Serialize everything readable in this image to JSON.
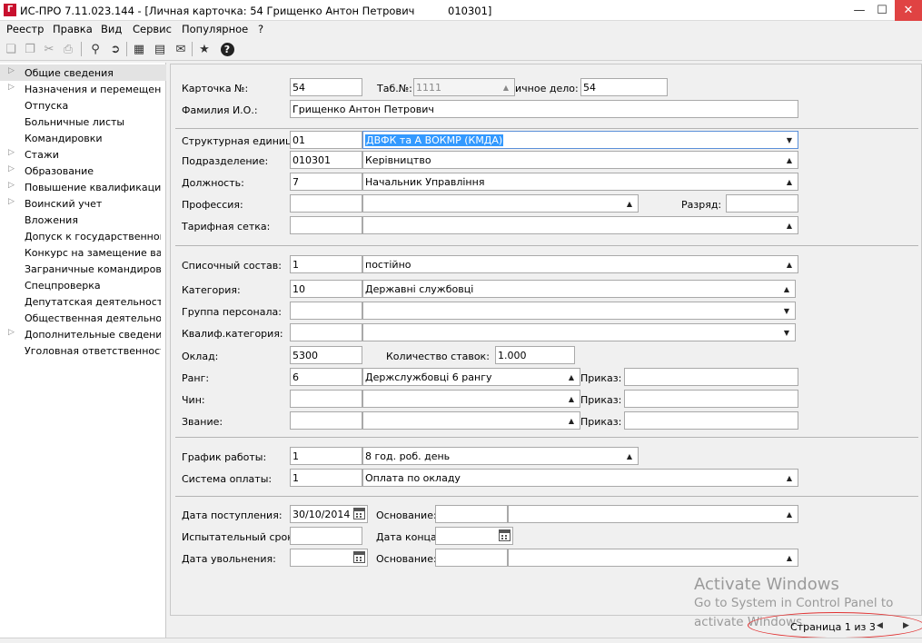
{
  "window": {
    "title": "ИС-ПРО 7.11.023.144 - [Личная карточка: 54 Грищенко Антон Петрович          010301]",
    "icon_text": "Г"
  },
  "menu": [
    "Реестр",
    "Правка",
    "Вид",
    "Сервис",
    "Популярное",
    "?"
  ],
  "toolbar": {
    "icons": [
      "copy-icon",
      "paste-icon",
      "cut-icon",
      "print-icon",
      "search-icon",
      "find-next-icon",
      "chart-icon",
      "document-icon",
      "mail-icon",
      "star-icon",
      "help-icon"
    ]
  },
  "nav": {
    "items": [
      {
        "label": "Общие сведения",
        "expander": "▷"
      },
      {
        "label": "Назначения и перемещения",
        "expander": "▷"
      },
      {
        "label": "Отпуска",
        "expander": ""
      },
      {
        "label": "Больничные листы",
        "expander": ""
      },
      {
        "label": "Командировки",
        "expander": ""
      },
      {
        "label": "Стажи",
        "expander": "▷"
      },
      {
        "label": "Образование",
        "expander": "▷"
      },
      {
        "label": "Повышение квалификации",
        "expander": "▷"
      },
      {
        "label": "Воинский учет",
        "expander": "▷"
      },
      {
        "label": "Вложения",
        "expander": ""
      },
      {
        "label": "Допуск к государственной...",
        "expander": ""
      },
      {
        "label": "Конкурс на замещение вак...",
        "expander": ""
      },
      {
        "label": "Заграничные командировки",
        "expander": ""
      },
      {
        "label": "Спецпроверка",
        "expander": ""
      },
      {
        "label": "Депутатская деятельность",
        "expander": ""
      },
      {
        "label": "Общественная деятельно...",
        "expander": ""
      },
      {
        "label": "Дополнительные сведени...",
        "expander": "▷"
      },
      {
        "label": "Уголовная ответственность",
        "expander": ""
      }
    ]
  },
  "card": {
    "card_label": "Карточка  №:",
    "card_no": "54",
    "tab_label": "Таб.№:",
    "tab_value": "1111",
    "file_label": "ичное дело:",
    "file_value": "54",
    "fio_label": "Фамилия И.О.:",
    "fio_value": "Грищенко Антон Петрович"
  },
  "org": {
    "unit_label": "Структурная единица:",
    "unit_code": "01",
    "unit_name": "ДВФК та А ВОКМР (КМДА)",
    "dept_label": "Подразделение:",
    "dept_code": "010301",
    "dept_name": "Керівництво",
    "pos_label": "Должность:",
    "pos_code": "7",
    "pos_name": "Начальник Управління",
    "prof_label": "Профессия:",
    "prof_code": "",
    "prof_name": "",
    "grade_label": "Разряд:",
    "grade_value": "",
    "tariff_label": "Тарифная сетка:",
    "tariff_code": "",
    "tariff_name": ""
  },
  "staff": {
    "list_label": "Списочный состав:",
    "list_code": "1",
    "list_name": "постійно",
    "cat_label": "Категория:",
    "cat_code": "10",
    "cat_name": "Державні службовці",
    "group_label": "Группа персонала:",
    "group_code": "",
    "group_name": "",
    "qual_label": "Квалиф.категория:",
    "qual_code": "",
    "qual_name": "",
    "salary_label": "Оклад:",
    "salary_value": "5300",
    "rates_label": "Количество ставок:",
    "rates_value": "1.000",
    "rank_label": "Ранг:",
    "rank_code": "6",
    "rank_name": "Держслужбовці 6 рангу",
    "rank_order_label": "Приказ:",
    "rank_order": "",
    "chin_label": "Чин:",
    "chin_code": "",
    "chin_name": "",
    "chin_order_label": "Приказ:",
    "chin_order": "",
    "title_label": "Звание:",
    "title_code": "",
    "title_name": "",
    "title_order_label": "Приказ:",
    "title_order": ""
  },
  "work": {
    "schedule_label": "График работы:",
    "schedule_code": "1",
    "schedule_name": "8 год. роб. день",
    "pay_label": "Система оплаты:",
    "pay_code": "1",
    "pay_name": "Оплата по окладу"
  },
  "dates": {
    "hire_label": "Дата поступления:",
    "hire_date": "30/10/2014",
    "hire_basis_label": "Основание:",
    "hire_basis_code": "",
    "hire_basis_name": "",
    "trial_label": "Испытательный срок:",
    "trial_value": "",
    "end_label": "Дата конца:",
    "end_value": "",
    "fire_label": "Дата увольнения:",
    "fire_date": "",
    "fire_basis_label": "Основание:",
    "fire_basis_code": "",
    "fire_basis_name": ""
  },
  "pager": {
    "text": "Страница 1 из 3"
  },
  "watermark": {
    "line1": "Activate Windows",
    "line2": "Go to System in Control Panel to",
    "line3": "activate Windows."
  }
}
